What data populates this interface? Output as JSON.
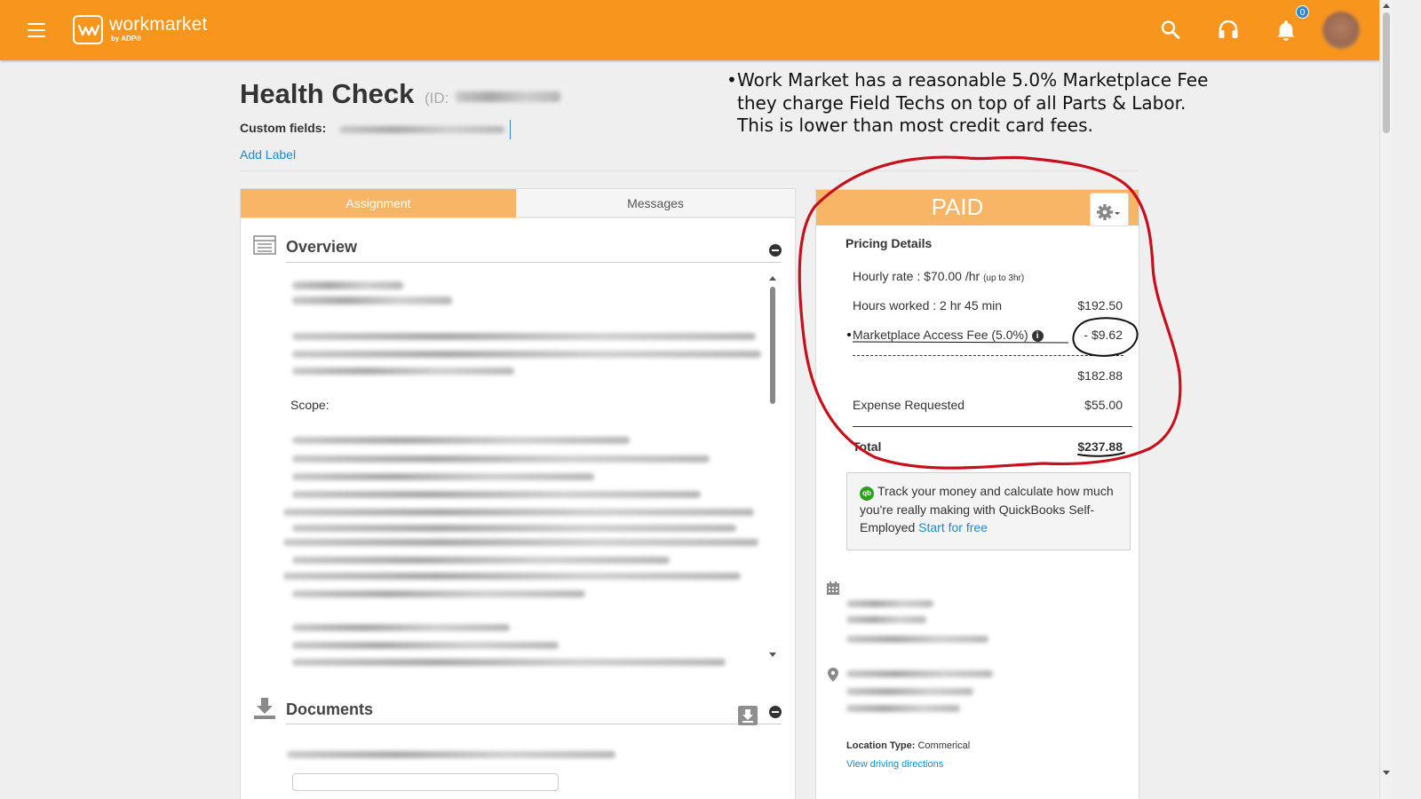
{
  "topbar": {
    "brand": "workmarket",
    "brand_sub": "by ADP®",
    "notification_count": "0",
    "icons": [
      "menu-icon",
      "search-icon",
      "headset-icon",
      "bell-icon"
    ]
  },
  "header": {
    "title": "Health Check",
    "id_prefix": "(ID:",
    "custom_fields_label": "Custom fields:",
    "add_label": "Add Label"
  },
  "annotation": {
    "bullet": "•",
    "text": "Work Market has a reasonable 5.0% Marketplace Fee they charge Field Techs on top of all Parts & Labor. This is lower than most credit card fees."
  },
  "tabs": [
    {
      "label": "Assignment",
      "active": true
    },
    {
      "label": "Messages",
      "active": false
    }
  ],
  "overview": {
    "title": "Overview",
    "scope_label": "Scope:"
  },
  "documents": {
    "title": "Documents"
  },
  "status": {
    "label": "PAID"
  },
  "pricing": {
    "title": "Pricing Details",
    "hourly_rate_label": "Hourly rate : $70.00 /hr",
    "hourly_rate_note": "(up to 3hr)",
    "hours_worked_label": "Hours worked : 2 hr 45 min",
    "hours_worked_value": "$192.50",
    "fee_label": "Marketplace Access Fee (5.0%)",
    "fee_value": "- $9.62",
    "subtotal_value": "$182.88",
    "expense_label": "Expense Requested",
    "expense_value": "$55.00",
    "total_label": "Total",
    "total_value": "$237.88"
  },
  "quickbooks": {
    "logo": "qb",
    "text": "Track your money and calculate how much you're really making with QuickBooks Self-Employed",
    "link": "Start for free"
  },
  "location": {
    "type_label": "Location Type:",
    "type_value": "Commerical",
    "directions_link": "View driving directions"
  },
  "colors": {
    "brand_orange": "#f7951d",
    "tab_orange": "#f8b565",
    "link_blue": "#1f8ac9",
    "annotation_red": "#c8101c"
  }
}
